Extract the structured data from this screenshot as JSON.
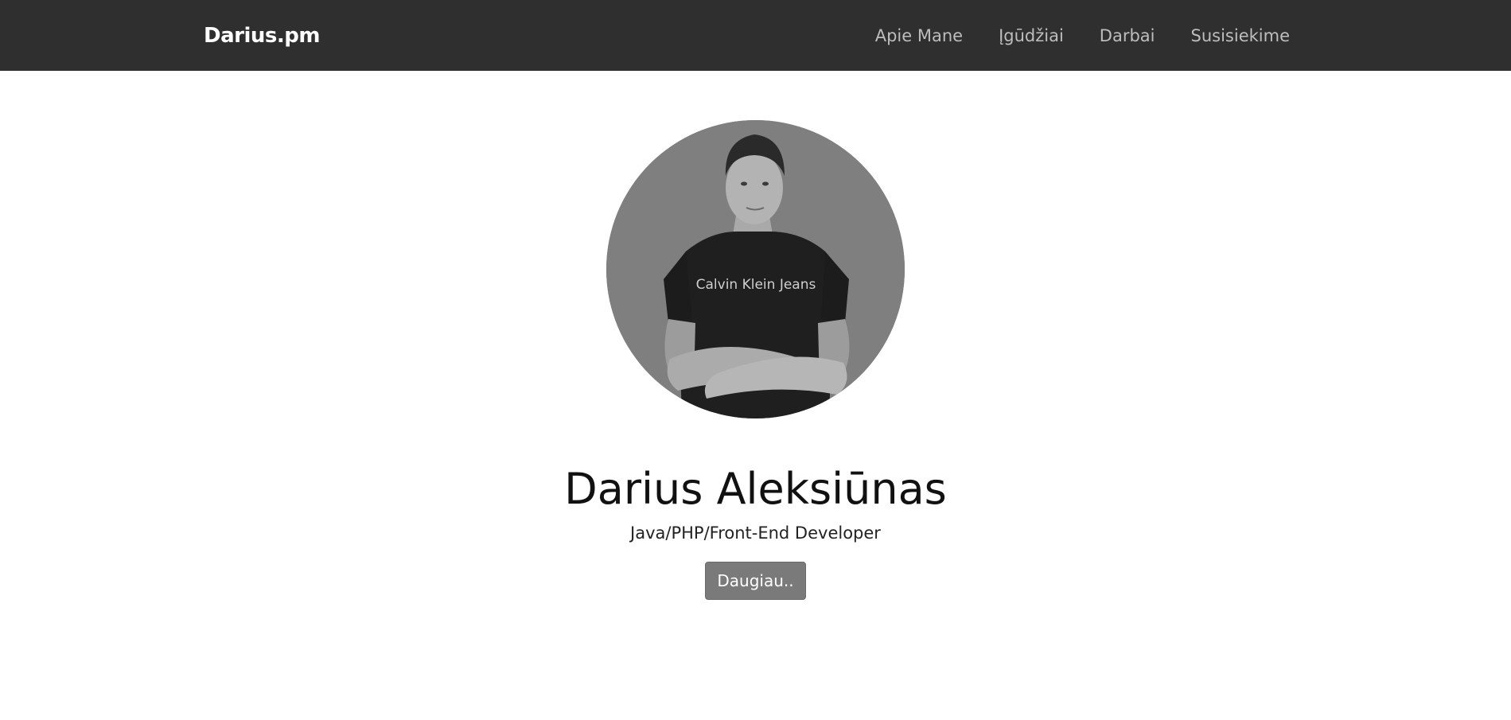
{
  "navbar": {
    "brand": "Darius.pm",
    "links": [
      {
        "label": "Apie Mane"
      },
      {
        "label": "Įgūdžiai"
      },
      {
        "label": "Darbai"
      },
      {
        "label": "Susisiekime"
      }
    ]
  },
  "hero": {
    "avatar_icon": "profile-photo",
    "shirt_text": "Calvin Klein Jeans",
    "name": "Darius Aleksiūnas",
    "subtitle": "Java/PHP/Front-End Developer",
    "more_button": "Daugiau.."
  },
  "colors": {
    "navbar_bg": "#2f2f2f",
    "nav_link": "#bdbdbd",
    "avatar_bg": "#7f7f7f",
    "button_bg": "#7a7a7a"
  }
}
